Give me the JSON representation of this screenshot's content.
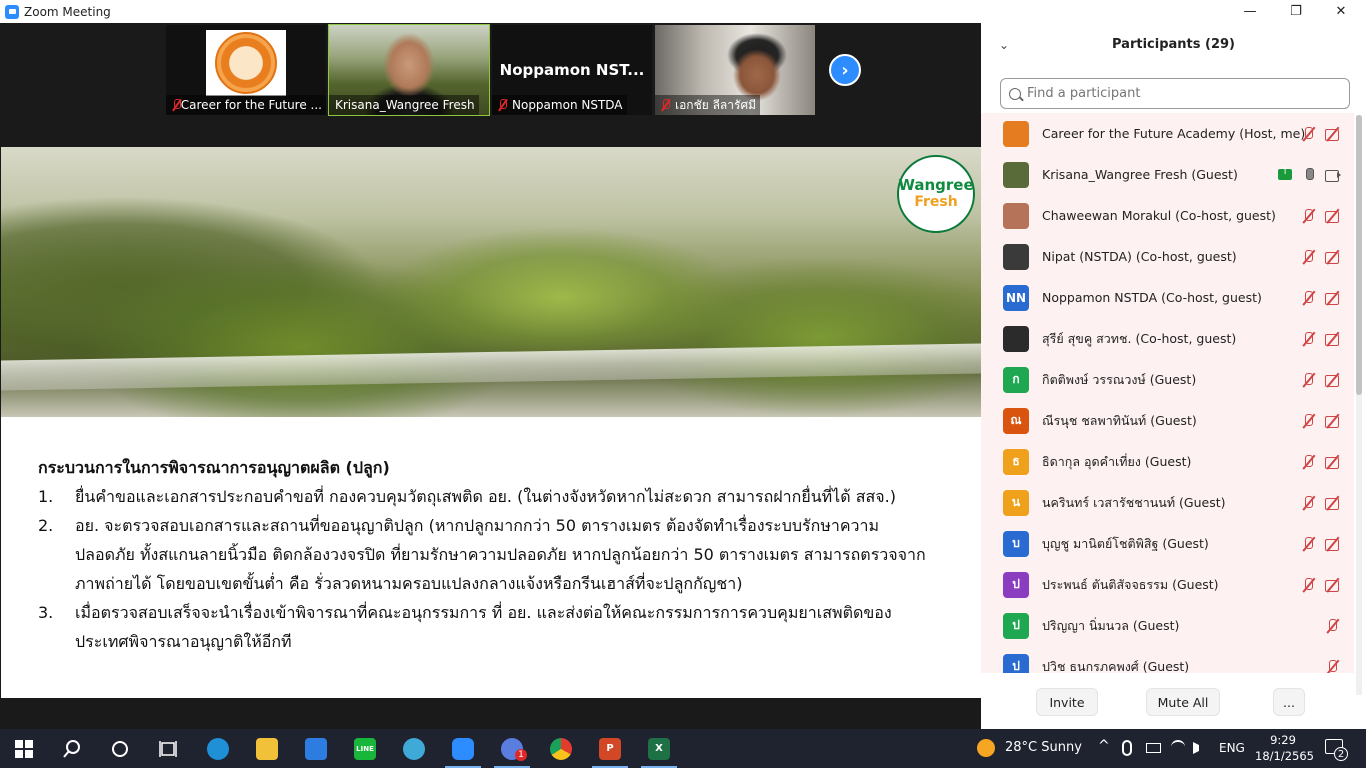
{
  "window": {
    "title": "Zoom Meeting",
    "minimize_glyph": "—",
    "maximize_glyph": "❐",
    "close_glyph": "✕"
  },
  "thumbnails": [
    {
      "name": "Career for the Future ...",
      "muted": true,
      "kind": "logo"
    },
    {
      "name": "Krisana_Wangree Fresh",
      "muted": false,
      "kind": "video",
      "active": true
    },
    {
      "name": "Noppamon NSTDA",
      "muted": true,
      "kind": "name",
      "display": "Noppamon  NST..."
    },
    {
      "name": "เอกชัย ลีลารัศมี",
      "muted": true,
      "kind": "video"
    }
  ],
  "next_button": "›",
  "slide": {
    "logo_line1": "Wangree",
    "logo_line2": "Fresh",
    "heading": "กระบวนการในการพิจารณาการอนุญาตผลิต (ปลูก)",
    "items": [
      {
        "num": "1.",
        "text": "ยื่นคำขอและเอกสารประกอบคำขอที่ กองควบคุมวัตถุเสพติด อย. (ในต่างจังหวัดหากไม่สะดวก สามารถฝากยื่นที่ได้ สสจ.)"
      },
      {
        "num": "2.",
        "text": "อย. จะตรวจสอบเอกสารและสถานที่ขออนุญาติปลูก (หากปลูกมากกว่า 50 ตารางเมตร ต้องจัดทำเรื่องระบบรักษาความปลอดภัย ทั้งสแกนลายนิ้วมือ ติดกล้องวงจรปิด ที่ยามรักษาความปลอดภัย หากปลูกน้อยกว่า 50 ตารางเมตร สามารถตรวจจากภาพถ่ายได้ โดยขอบเขตขั้นต่ำ คือ รั่วลวดหนามครอบแปลงกลางแจ้งหรือกรีนเฮาส์ที่จะปลูกกัญชา)"
      },
      {
        "num": "3.",
        "text": "เมื่อตรวจสอบเสร็จจะนำเรื่องเข้าพิจารณาที่คณะอนุกรรมการ ที่ อย. และส่งต่อให้คณะกรรมการการควบคุมยาเสพติดของ ประเทศพิจารณาอนุญาติให้อีกที"
      }
    ]
  },
  "participants_panel": {
    "collapse_glyph": "⌄",
    "title": "Participants (29)",
    "search_placeholder": "Find a participant",
    "participants": [
      {
        "name": "Career for the Future Academy (Host, me)",
        "avatar": "",
        "avatar_color": "#e57c1f",
        "mic": "off",
        "cam": "off",
        "highlight": true
      },
      {
        "name": "Krisana_Wangree Fresh (Guest)",
        "avatar": "",
        "avatar_color": "#5a6b3a",
        "mic": "on",
        "cam": "on",
        "sharing": true,
        "highlight": true
      },
      {
        "name": "Chaweewan Morakul (Co-host, guest)",
        "avatar": "",
        "avatar_color": "#b5735a",
        "mic": "off",
        "cam": "off",
        "highlight": true
      },
      {
        "name": "Nipat (NSTDA) (Co-host, guest)",
        "avatar": "",
        "avatar_color": "#3a3a3a",
        "mic": "off",
        "cam": "off",
        "highlight": true
      },
      {
        "name": "Noppamon NSTDA (Co-host, guest)",
        "avatar": "NN",
        "avatar_color": "#2a6bd1",
        "mic": "off",
        "cam": "off",
        "highlight": true
      },
      {
        "name": "สุรีย์ สุขคู สวทช. (Co-host, guest)",
        "avatar": "",
        "avatar_color": "#2b2b2b",
        "mic": "off",
        "cam": "off",
        "highlight": true
      },
      {
        "name": "กิตติพงษ์  วรรณวงษ์ (Guest)",
        "avatar": "ก",
        "avatar_color": "#1fa851",
        "mic": "off",
        "cam": "off",
        "highlight": true
      },
      {
        "name": "ณีรนุช ชลพาทินันท์ (Guest)",
        "avatar": "ณ",
        "avatar_color": "#d9540f",
        "mic": "off",
        "cam": "off",
        "highlight": true
      },
      {
        "name": "ธิดากุล อุดคำเที่ยง (Guest)",
        "avatar": "ธ",
        "avatar_color": "#f0a11c",
        "mic": "off",
        "cam": "off",
        "highlight": true
      },
      {
        "name": "นครินทร์ เวสารัชชานนท์ (Guest)",
        "avatar": "น",
        "avatar_color": "#f0a11c",
        "mic": "off",
        "cam": "off",
        "highlight": true
      },
      {
        "name": "บุญชู มานิตย์โชติพิสิฐ (Guest)",
        "avatar": "บ",
        "avatar_color": "#2a6bd1",
        "mic": "off",
        "cam": "off",
        "highlight": true
      },
      {
        "name": "ประพนธ์ ตันติสัจจธรรม (Guest)",
        "avatar": "ป",
        "avatar_color": "#8a3dbf",
        "mic": "off",
        "cam": "off",
        "highlight": true
      },
      {
        "name": "ปริญญา นิ่มนวล (Guest)",
        "avatar": "ป",
        "avatar_color": "#1fa851",
        "mic": "off",
        "cam": "none",
        "highlight": true
      },
      {
        "name": "ปวิช ธนกรภคพงศ์ (Guest)",
        "avatar": "ป",
        "avatar_color": "#2a6bd1",
        "mic": "off",
        "cam": "none",
        "highlight": true
      }
    ],
    "footer": {
      "invite": "Invite",
      "mute_all": "Mute All",
      "more": "..."
    }
  },
  "taskbar": {
    "weather": "28°C  Sunny",
    "language": "ENG",
    "time": "9:29",
    "date": "18/1/2565",
    "notifications": "2",
    "chevron": "^",
    "mail_badge": "1",
    "apps": [
      {
        "name": "start",
        "label": ""
      },
      {
        "name": "search",
        "label": ""
      },
      {
        "name": "cortana",
        "label": ""
      },
      {
        "name": "task-view",
        "label": ""
      },
      {
        "name": "edge",
        "label": ""
      },
      {
        "name": "file-explorer",
        "label": ""
      },
      {
        "name": "mail",
        "label": ""
      },
      {
        "name": "line",
        "label": "LINE"
      },
      {
        "name": "globe",
        "label": ""
      },
      {
        "name": "zoom",
        "label": ""
      },
      {
        "name": "messenger",
        "label": ""
      },
      {
        "name": "chrome",
        "label": ""
      },
      {
        "name": "powerpoint",
        "label": "P"
      },
      {
        "name": "excel",
        "label": "X"
      }
    ]
  }
}
